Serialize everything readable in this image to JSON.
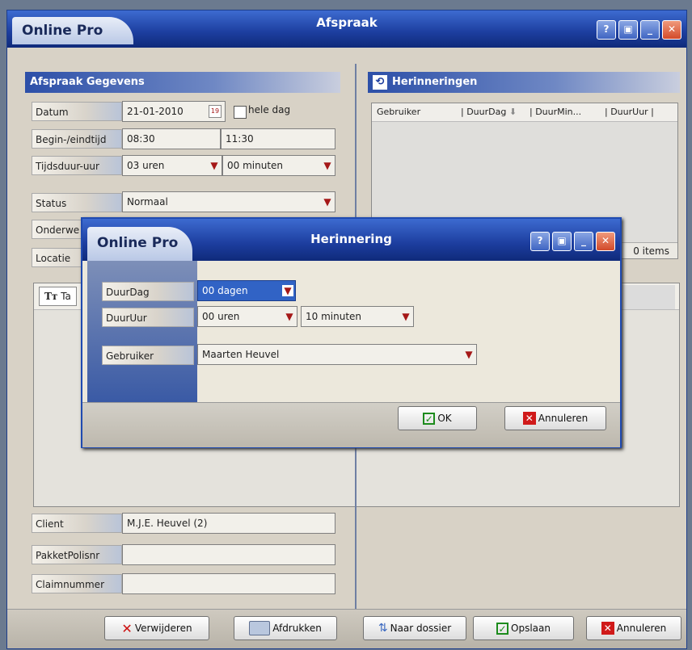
{
  "main": {
    "app_name": "Online Pro",
    "title": "Afspraak",
    "left_section": {
      "header": "Afspraak Gegevens",
      "datum_label": "Datum",
      "datum_value": "21-01-2010",
      "calendar_day": "19",
      "hele_dag_label": "hele dag",
      "begin_eind_label": "Begin-/eindtijd",
      "begin_value": "08:30",
      "eind_value": "11:30",
      "tijdsduur_label": "Tijdsduur-uur",
      "uren_value": "03 uren",
      "minuten_value": "00 minuten",
      "status_label": "Status",
      "status_value": "Normaal",
      "onderwerp_label": "Onderwe",
      "locatie_label": "Locatie",
      "toolbar_partial": "Ta",
      "client_label": "Client",
      "client_value": "M.J.E. Heuvel (2)",
      "pakket_label": "PakketPolisnr",
      "claim_label": "Claimnummer"
    },
    "right_section": {
      "header": "Herinneringen",
      "columns": [
        "Gebruiker",
        "DuurDag",
        "DuurMin...",
        "DuurUur"
      ],
      "items_count": "0 items"
    },
    "footer": {
      "verwijderen": "Verwijderen",
      "afdrukken": "Afdrukken",
      "naar_dossier": "Naar dossier",
      "opslaan": "Opslaan",
      "annuleren": "Annuleren"
    }
  },
  "dialog": {
    "app_name": "Online Pro",
    "title": "Herinnering",
    "duurdag_label": "DuurDag",
    "duurdag_value": "00 dagen",
    "duuruur_label": "DuurUur",
    "duuruur_value": "00 uren",
    "minuten_value": "10 minuten",
    "gebruiker_label": "Gebruiker",
    "gebruiker_value": "Maarten Heuvel",
    "ok": "OK",
    "annuleren": "Annuleren"
  },
  "colors": {
    "titlebar": "#1c3d9e",
    "close": "#d24a2a",
    "accent_red": "#a51818"
  }
}
